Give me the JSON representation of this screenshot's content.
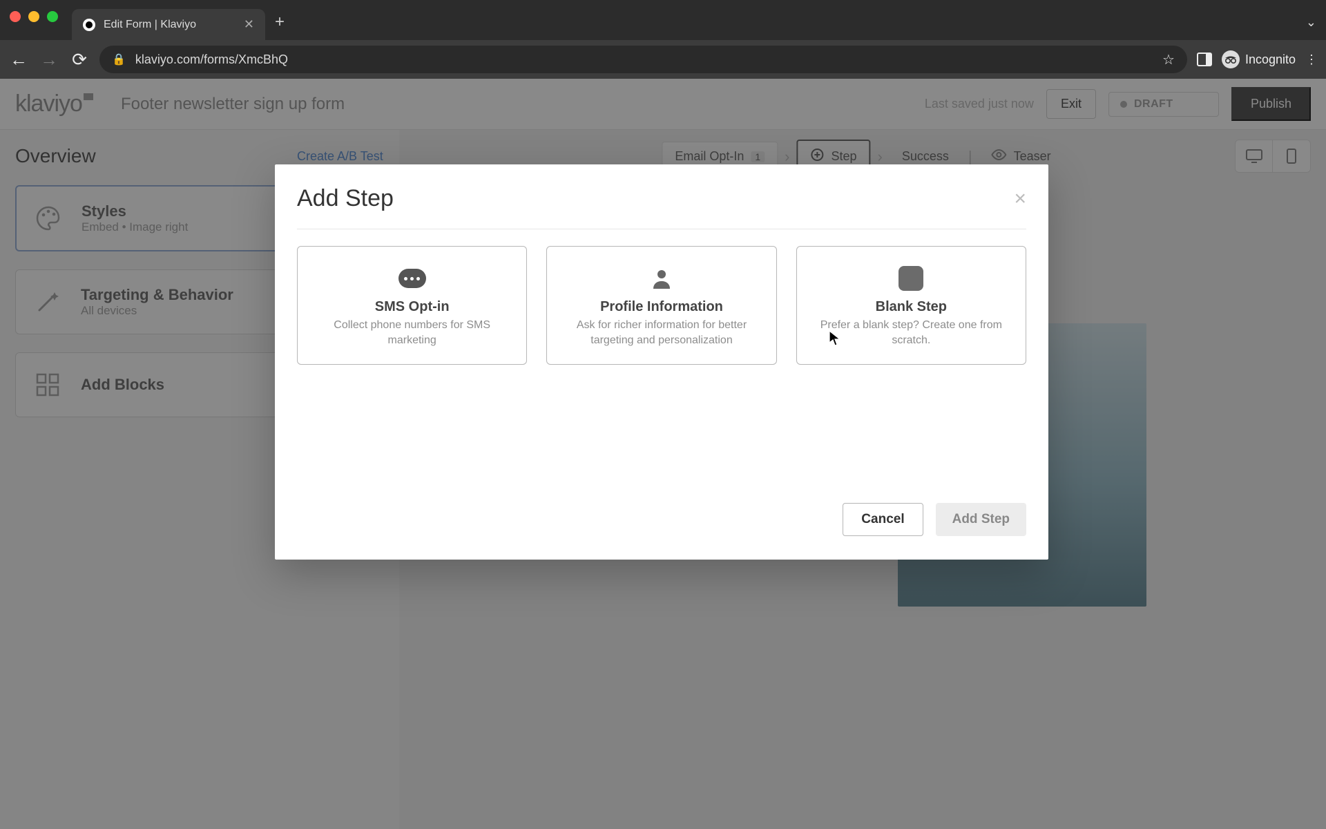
{
  "browser": {
    "tab_title": "Edit Form | Klaviyo",
    "url": "klaviyo.com/forms/XmcBhQ",
    "incognito_label": "Incognito"
  },
  "header": {
    "logo_text": "klaviyo",
    "form_name": "Footer newsletter sign up form",
    "saved_text": "Last saved just now",
    "exit_label": "Exit",
    "status_label": "DRAFT",
    "publish_label": "Publish"
  },
  "sidebar": {
    "overview_label": "Overview",
    "ab_test_label": "Create A/B Test",
    "panels": [
      {
        "title": "Styles",
        "sub": "Embed • Image right"
      },
      {
        "title": "Targeting & Behavior",
        "sub": "All devices"
      },
      {
        "title": "Add Blocks",
        "sub": ""
      }
    ]
  },
  "canvas": {
    "steps": [
      {
        "label": "Email Opt-In",
        "badge": "1"
      },
      {
        "label": "Step"
      },
      {
        "label": "Success"
      },
      {
        "label": "Teaser"
      }
    ]
  },
  "modal": {
    "title": "Add Step",
    "options": [
      {
        "title": "SMS Opt-in",
        "desc": "Collect phone numbers for SMS marketing"
      },
      {
        "title": "Profile Information",
        "desc": "Ask for richer information for better targeting and personalization"
      },
      {
        "title": "Blank Step",
        "desc": "Prefer a blank step? Create one from scratch."
      }
    ],
    "cancel_label": "Cancel",
    "confirm_label": "Add Step"
  }
}
